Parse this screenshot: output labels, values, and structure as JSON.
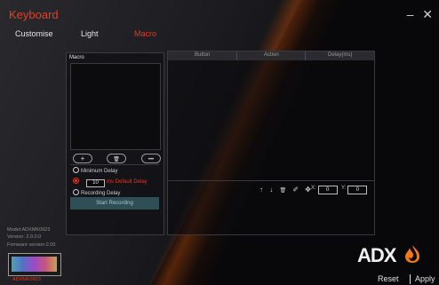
{
  "app": {
    "title": "Keyboard"
  },
  "window": {
    "minimize": "–",
    "close": "✕"
  },
  "nav": {
    "tabs": [
      "Customise",
      "Light",
      "Macro"
    ],
    "active": "Macro"
  },
  "macro": {
    "title": "Macro",
    "buttons": {
      "add": "+",
      "delete": "🗑",
      "more": "•••"
    },
    "options": {
      "minimum_delay": "Minimum Delay",
      "default_delay_value": "10",
      "default_delay_label": "ms Default Delay",
      "recording_delay": "Recording Delay"
    },
    "start_recording": "Start Recording"
  },
  "table": {
    "columns": [
      "Button",
      "Action",
      "Delay(ms)"
    ],
    "tools": {
      "up": "↑",
      "down": "↓",
      "delete": "🗑",
      "edit": "✐",
      "move": "✥"
    },
    "x_label": "X:",
    "x_value": "0",
    "y_label": "Y:",
    "y_value": "0"
  },
  "device": {
    "model": "Model:ADXMK0923",
    "version": "Version: 2.0.0.0",
    "firmware": "Firmware version:2.00",
    "keyboard_name": "ADXMK0923"
  },
  "brand": {
    "logo": "ADX"
  },
  "footer": {
    "reset": "Reset",
    "apply": "Apply"
  },
  "colors": {
    "accent": "#e2381f",
    "button": "#2f4f56"
  }
}
